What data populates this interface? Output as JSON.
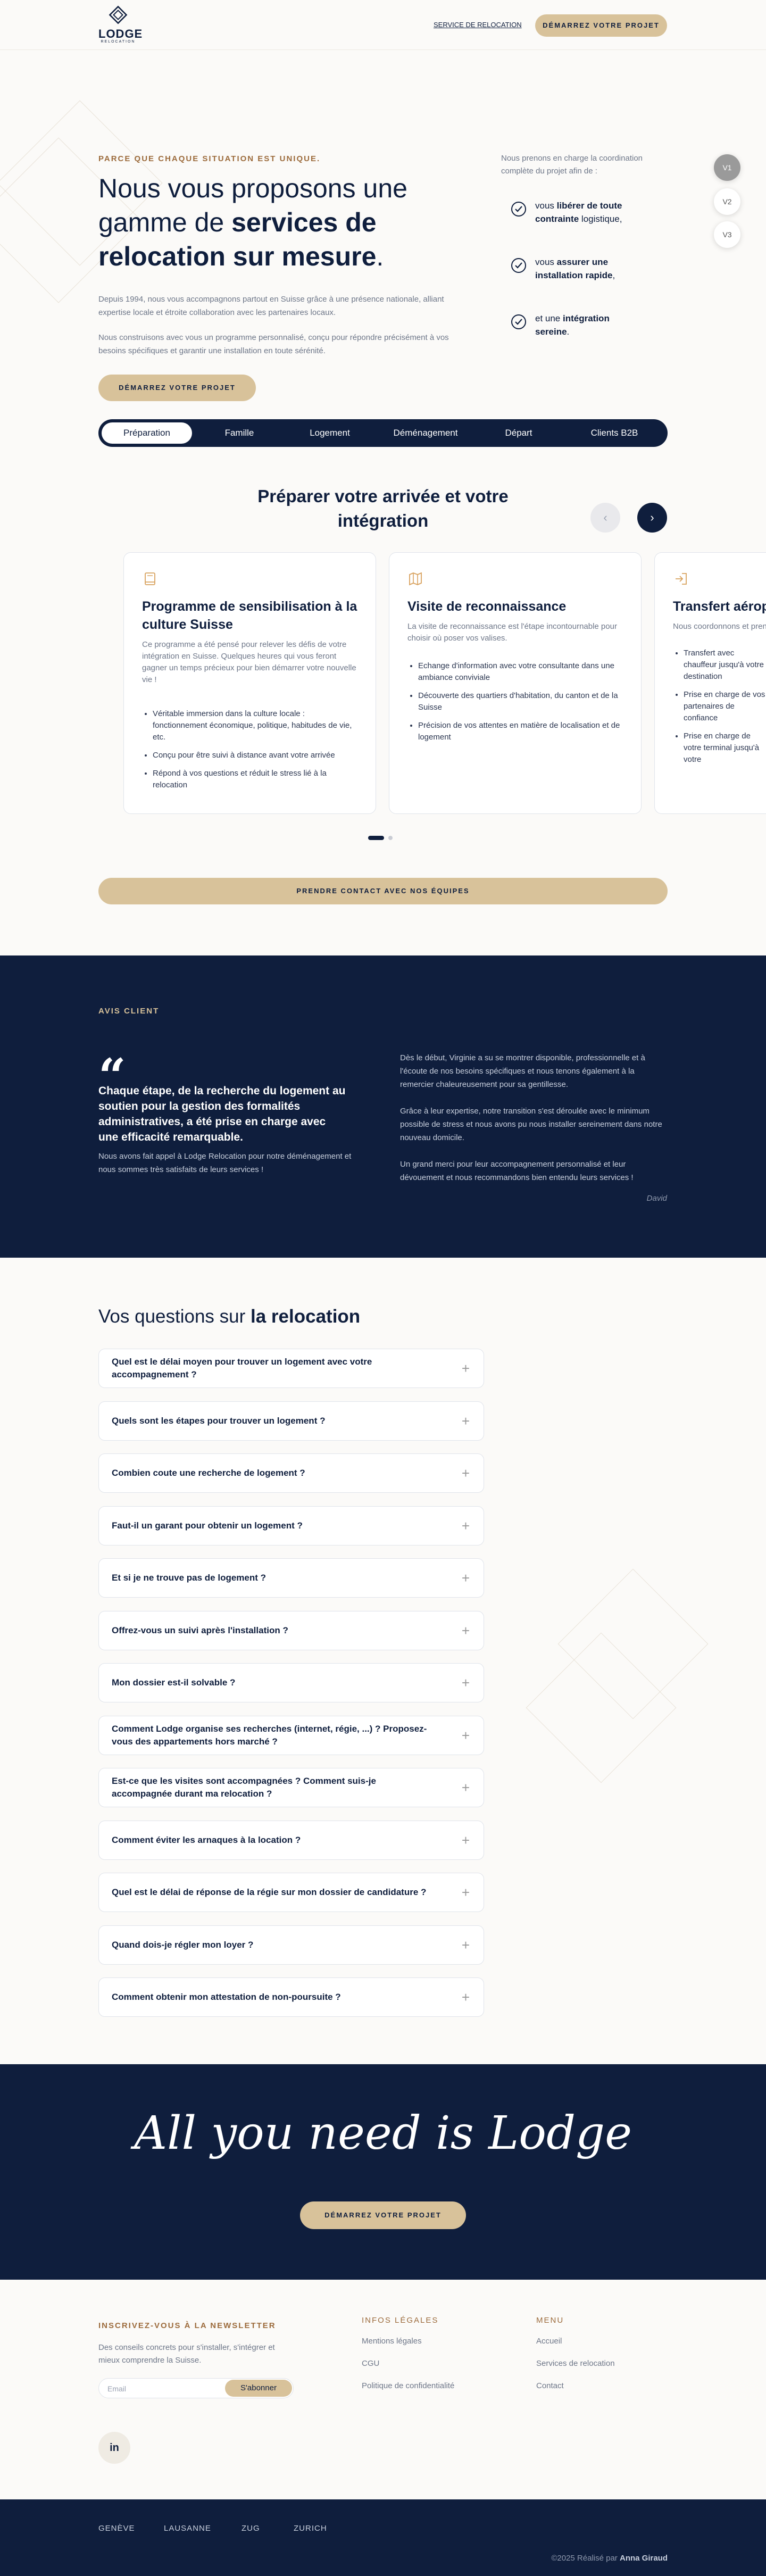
{
  "header": {
    "logo_word": "LODGE",
    "logo_sub": "RELOCATION",
    "nav_link": "SERVICE DE RELOCATION",
    "cta": "DÉMARREZ VOTRE PROJET"
  },
  "hero": {
    "kicker": "PARCE QUE CHAQUE SITUATION EST UNIQUE.",
    "title_pre": "Nous vous proposons une gamme de ",
    "title_bold": "services de relocation sur mesure",
    "title_post": ".",
    "p1": "Depuis 1994, nous vous accompagnons partout en Suisse grâce à une présence nationale, alliant expertise locale et étroite collaboration avec les partenaires locaux.",
    "p2": "Nous construisons avec vous un programme personnalisé, conçu pour répondre précisément à vos besoins spécifiques et garantir une installation en toute sérénité.",
    "button": "DÉMARREZ VOTRE PROJET",
    "coord_intro": "Nous prenons en charge la coordination complète du projet afin de :",
    "features": [
      {
        "pre": "vous ",
        "bold": "libérer de toute contrainte",
        "post": " logistique,"
      },
      {
        "pre": "vous ",
        "bold": "assurer une installation rapide",
        "post": ","
      },
      {
        "pre": "et une ",
        "bold": "intégration sereine",
        "post": "."
      }
    ],
    "versions": [
      "V1",
      "V2",
      "V3"
    ]
  },
  "tabs": [
    "Préparation",
    "Famille",
    "Logement",
    "Déménagement",
    "Départ",
    "Clients B2B"
  ],
  "section": {
    "title": "Préparer votre arrivée et votre intégration",
    "prev": "‹",
    "next": "›"
  },
  "cards": [
    {
      "icon": "book-icon",
      "title": "Programme de sensibilisation à la culture Suisse",
      "lead": "Ce programme a été pensé pour relever les défis de votre intégration en Suisse. Quelques heures qui vous feront gagner un temps précieux pour bien démarrer votre nouvelle vie !",
      "items": [
        "Véritable immersion dans la culture locale : fonctionnement économique, politique, habitudes de vie, etc.",
        "Conçu pour être suivi à distance avant votre arrivée",
        "Répond à vos questions et réduit le stress lié à la relocation"
      ]
    },
    {
      "icon": "map-icon",
      "title": "Visite de reconnaissance",
      "lead": "La visite de reconnaissance est l'étape incontournable pour choisir où poser vos valises.",
      "items": [
        "Echange d'information avec votre consultante dans une ambiance conviviale",
        "Découverte des quartiers d'habitation, du canton et de la Suisse",
        "Précision de vos attentes en matière de localisation et de logement"
      ]
    },
    {
      "icon": "login-icon",
      "title": "Transfert aéroport",
      "lead": "Nous coordonnons et prenons en charge",
      "items": [
        "Transfert avec chauffeur jusqu'à votre destination",
        "Prise en charge de vos partenaires de confiance",
        "Prise en charge de votre terminal jusqu'à votre"
      ]
    }
  ],
  "contact_button": "PRENDRE CONTACT AVEC NOS ÉQUIPES",
  "review": {
    "kicker": "AVIS CLIENT",
    "quote_mark": "“",
    "quote": "Chaque étape, de la recherche du logement au soutien pour la gestion des formalités administratives, a été prise en charge avec une efficacité remarquable.",
    "sub": "Nous avons fait appel à Lodge Relocation pour notre déménagement et nous sommes très satisfaits de leurs services !",
    "paragraphs": [
      "Dès le début, Virginie a su se montrer disponible, professionnelle et à l'écoute de nos besoins spécifiques et nous tenons également à la remercier chaleureusement pour sa gentillesse.",
      "Grâce à leur expertise, notre transition s'est déroulée avec le minimum possible de stress et nous avons pu nous installer sereinement dans notre nouveau domicile.",
      "Un grand merci pour leur accompagnement personnalisé et leur dévouement et nous recommandons bien entendu leurs services !"
    ],
    "author": "David"
  },
  "faq": {
    "title_pre": "Vos questions sur ",
    "title_bold": "la relocation",
    "items": [
      "Quel est le délai moyen pour trouver un logement avec votre accompagnement ?",
      "Quels sont les étapes pour trouver un logement ?",
      "Combien coute une recherche de logement ?",
      "Faut-il un garant pour obtenir un logement ?",
      "Et si je ne trouve pas de logement ?",
      "Offrez-vous un suivi après l'installation ?",
      "Mon dossier est-il solvable ?",
      "Comment Lodge organise ses recherches (internet, régie, ...) ? Proposez-vous des appartements hors marché ?",
      "Est-ce que les visites sont accompagnées ? Comment suis-je accompagnée durant ma relocation ?",
      "Comment éviter les arnaques à la location ?",
      "Quel est le délai de réponse de la régie sur mon dossier de candidature ?",
      "Quand dois-je régler mon loyer ?",
      "Comment obtenir mon attestation de non-poursuite ?"
    ],
    "plus": "+"
  },
  "cta": {
    "script": "All you need is Lodge",
    "button": "DÉMARREZ VOTRE PROJET"
  },
  "footer": {
    "newsletter_title": "INSCRIVEZ-VOUS À LA NEWSLETTER",
    "newsletter_text": "Des conseils concrets pour s'installer, s'intégrer et mieux comprendre la Suisse.",
    "email_placeholder": "Email",
    "subscribe": "S'abonner",
    "linkedin": "in",
    "legal_title": "INFOS LÉGALES",
    "legal_links": [
      "Mentions légales",
      "CGU",
      "Politique de confidentialité"
    ],
    "menu_title": "MENU",
    "menu_links": [
      "Accueil",
      "Services de relocation",
      "Contact"
    ],
    "cities": [
      "GENÈVE",
      "LAUSANNE",
      "ZUG",
      "ZURICH"
    ],
    "credit_pre": "©2025 Réalisé par ",
    "credit_name": "Anna Giraud"
  },
  "colors": {
    "navy": "#0f1e3d",
    "sand": "#d8c29a",
    "accent_brown": "#9c6b3c",
    "background": "#fbfaf8"
  }
}
